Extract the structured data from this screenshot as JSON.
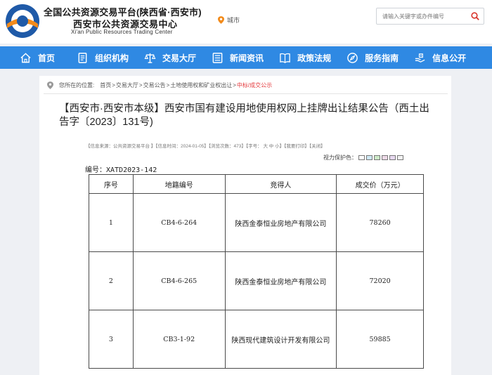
{
  "header": {
    "title": "全国公共资源交易平台(陕西省·西安市)",
    "subtitle": "西安市公共资源交易中心",
    "english": "Xi'an Public Resources Trading Center",
    "city_label": "城市",
    "search_placeholder": "请输入关键字或办件编号"
  },
  "nav": {
    "items": [
      {
        "label": "首页",
        "icon": "home-icon"
      },
      {
        "label": "组织机构",
        "icon": "document-icon"
      },
      {
        "label": "交易大厅",
        "icon": "scale-icon"
      },
      {
        "label": "新闻资讯",
        "icon": "news-icon"
      },
      {
        "label": "政策法规",
        "icon": "book-icon"
      },
      {
        "label": "服务指南",
        "icon": "compass-icon"
      },
      {
        "label": "信息公开",
        "icon": "hand-icon"
      }
    ]
  },
  "breadcrumb": {
    "prefix": "您所在的位置:",
    "items": [
      "首页",
      "交易大厅",
      "交易公告",
      "土地使用权和矿业权出让",
      "中标/成交公示"
    ],
    "separator": ">"
  },
  "article": {
    "title": "【西安市·西安市本级】西安市国有建设用地使用权网上挂牌出让结果公告（西土出告字〔2023〕131号)",
    "meta": "【信息来源：公共资源交易平台 】【信息时间：2024-01-05】【浏览次数：473】【字号： 大 中 小】【我要打印】【关闭】",
    "eye_label": "视力保护色：",
    "eye_colors": [
      "#ffffff",
      "#cfe8f5",
      "#cde9c8",
      "#ecd9e6",
      "#e7d9f0",
      "#f3f3f3"
    ],
    "code": "编号：XATD2023-142"
  },
  "table": {
    "headers": [
      "序号",
      "地籍编号",
      "竞得人",
      "成交价（万元）"
    ],
    "rows": [
      {
        "no": "1",
        "parcel": "CB4-6-264",
        "winner": "陕西金泰恒业房地产有限公司",
        "price": "78260"
      },
      {
        "no": "2",
        "parcel": "CB4-6-265",
        "winner": "陕西金泰恒业房地产有限公司",
        "price": "72020"
      },
      {
        "no": "3",
        "parcel": "CB3-1-92",
        "winner": "陕西现代建筑设计开发有限公司",
        "price": "59885"
      }
    ]
  },
  "colors": {
    "nav_bg": "#2f89e3",
    "highlight": "#e4393c",
    "logo_blue": "#1f5aa8",
    "logo_orange": "#f28a1a"
  }
}
